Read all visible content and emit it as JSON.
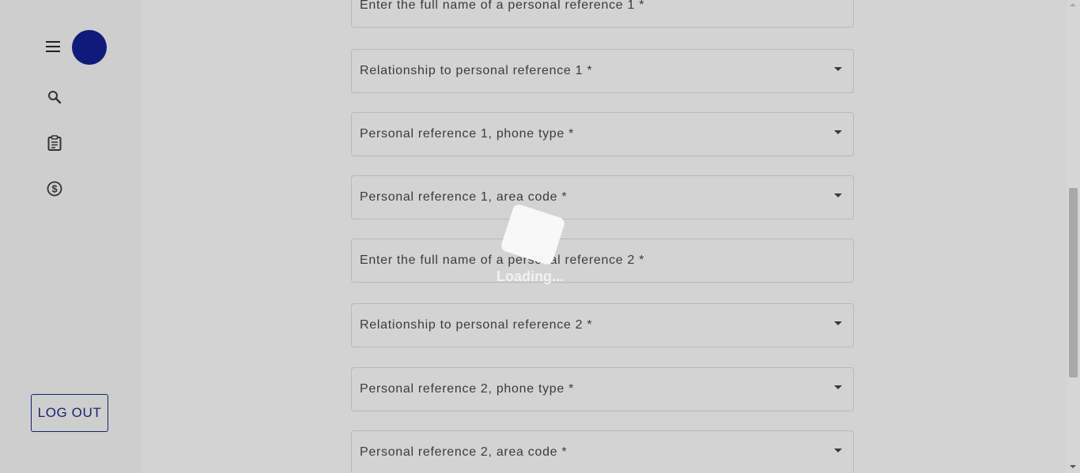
{
  "sidebar": {
    "menu_icon": "hamburger-menu-icon",
    "avatar_color": "#101a7a",
    "nav_icons": [
      "search-icon",
      "clipboard-icon",
      "dollar-circle-icon"
    ],
    "logout_label": "LOG OUT"
  },
  "form": {
    "fields": [
      {
        "label": "Enter the full name of a personal reference 1 *",
        "type": "text"
      },
      {
        "label": "Relationship to personal reference 1 *",
        "type": "select"
      },
      {
        "label": "Personal reference 1, phone type *",
        "type": "select"
      },
      {
        "label": "Personal reference 1, area code *",
        "type": "select"
      },
      {
        "label": "Enter the full name of a personal reference 2 *",
        "type": "text"
      },
      {
        "label": "Relationship to personal reference 2 *",
        "type": "select"
      },
      {
        "label": "Personal reference 2, phone type *",
        "type": "select"
      },
      {
        "label": "Personal reference 2, area code *",
        "type": "select"
      }
    ]
  },
  "loading": {
    "text": "Loading..."
  },
  "colors": {
    "accent": "#1b1f6e",
    "background": "#d3d3d3"
  }
}
